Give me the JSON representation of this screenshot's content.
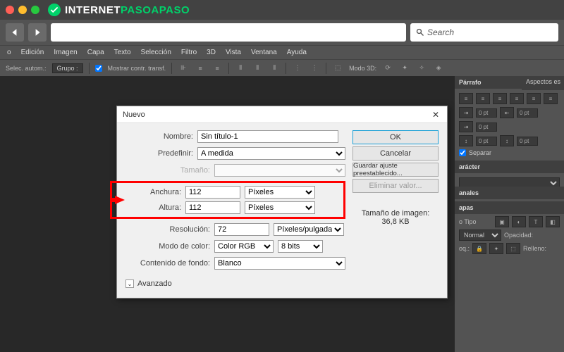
{
  "brand": {
    "part1": "INTERNET",
    "part2": "PASOAPASO"
  },
  "search": {
    "placeholder": "Search"
  },
  "menu": [
    "o",
    "Edición",
    "Imagen",
    "Capa",
    "Texto",
    "Selección",
    "Filtro",
    "3D",
    "Vista",
    "Ventana",
    "Ayuda"
  ],
  "toolbar": {
    "selec": "Selec. autom.:",
    "grupo": "Grupo :",
    "mostrar": "Mostrar contr. transf.",
    "modo3d": "Modo 3D:"
  },
  "aspects": "Aspectos es",
  "panel": {
    "parrafo": "Párrafo",
    "pt": "0 pt",
    "separar": "Separar",
    "caracter": "arácter",
    "normal": "Normal",
    "tipo": "o Tipo",
    "opacidad": "Opacidad:",
    "relleno": "Relleno:",
    "oq": "oq.:",
    "anales": "anales",
    "apas": "apas"
  },
  "dialog": {
    "title": "Nuevo",
    "labels": {
      "nombre": "Nombre:",
      "predefinir": "Predefinir:",
      "tamano": "Tamaño:",
      "anchura": "Anchura:",
      "altura": "Altura:",
      "resolucion": "Resolución:",
      "modocolor": "Modo de color:",
      "contenidofondo": "Contenido de fondo:",
      "avanzado": "Avanzado"
    },
    "values": {
      "nombre": "Sin título-1",
      "predefinir": "A medida",
      "anchura": "112",
      "altura": "112",
      "resolucion": "72",
      "unitPx": "Píxeles",
      "unitPpi": "Píxeles/pulgada",
      "colormode": "Color RGB",
      "bits": "8 bits",
      "fondo": "Blanco"
    },
    "buttons": {
      "ok": "OK",
      "cancelar": "Cancelar",
      "guardar": "Guardar ajuste preestablecido...",
      "eliminar": "Eliminar valor..."
    },
    "sizeLabel": "Tamaño de imagen:",
    "sizeValue": "36,8 KB"
  }
}
